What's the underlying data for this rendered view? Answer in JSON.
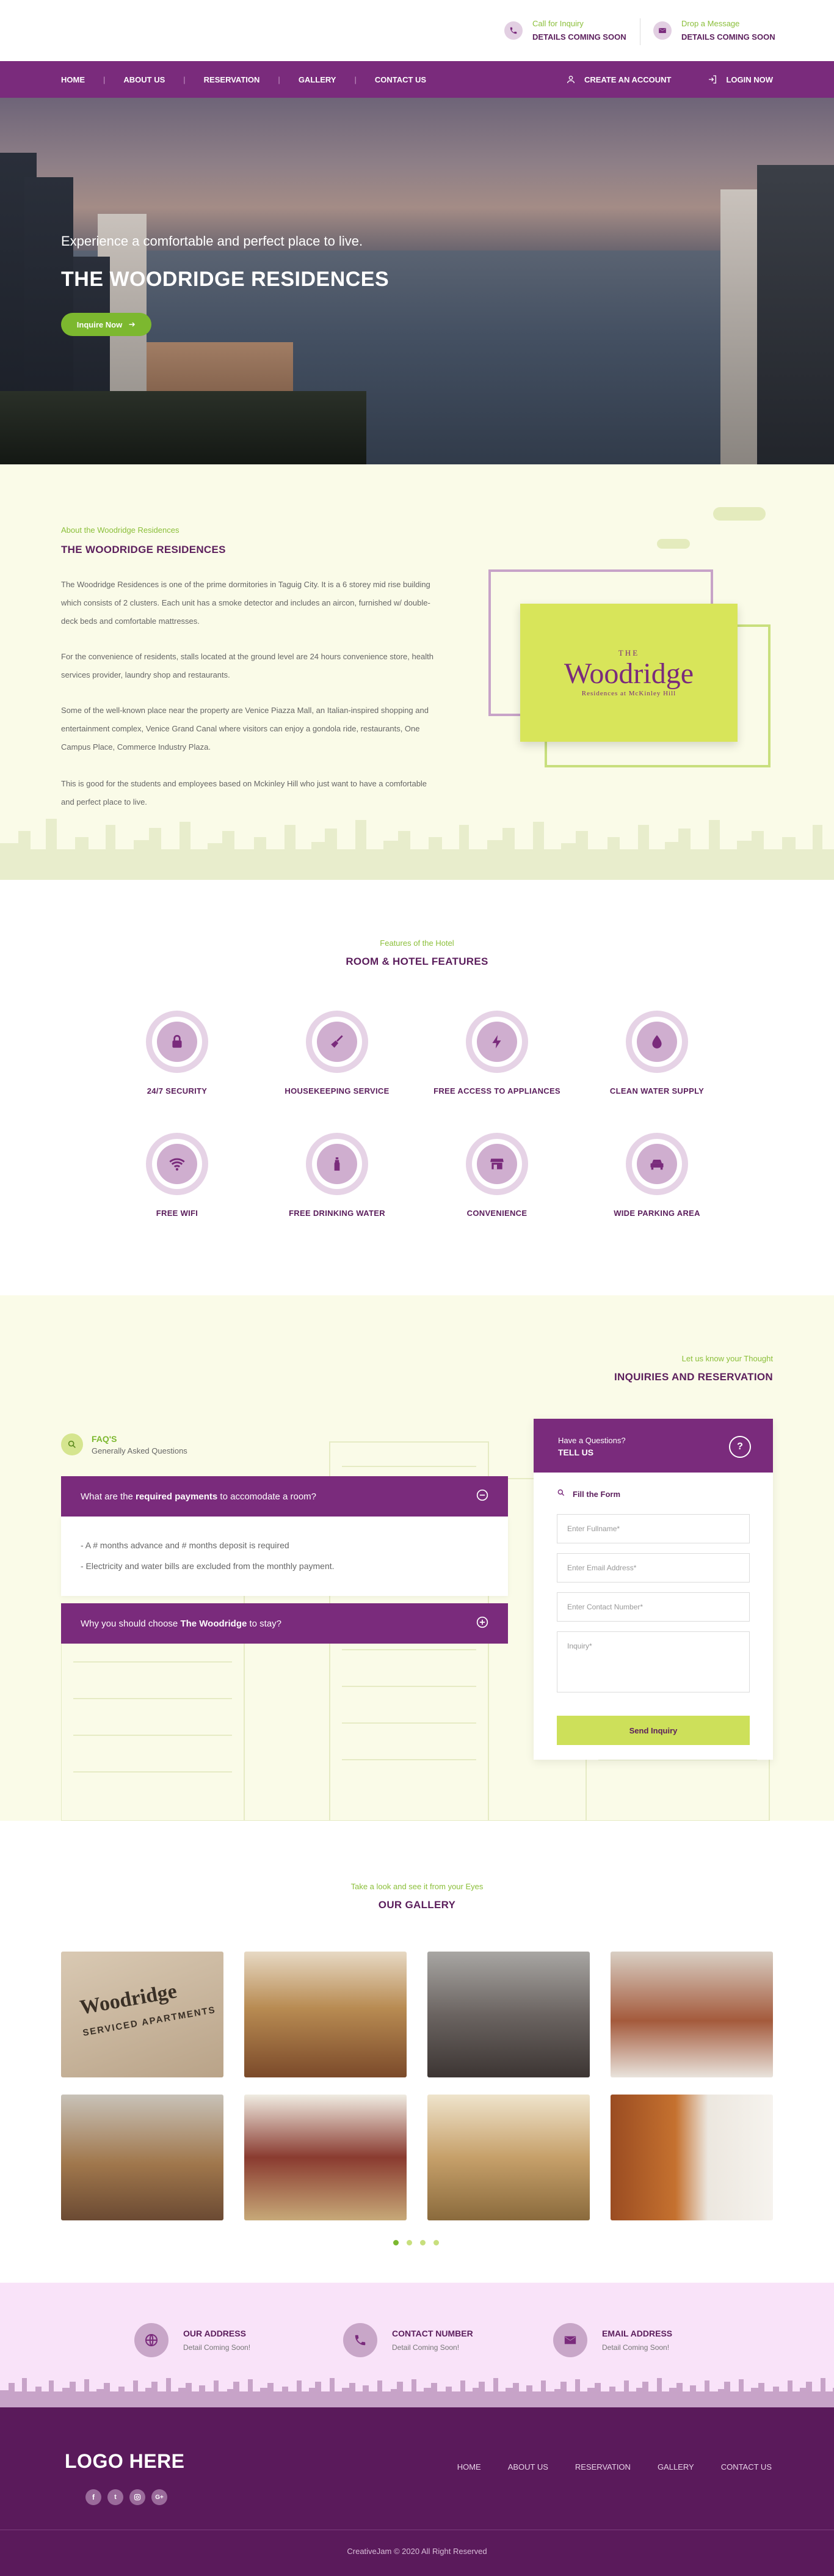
{
  "topbar": {
    "call": {
      "label": "Call for Inquiry",
      "value": "DETAILS COMING SOON",
      "icon": "phone-icon"
    },
    "message": {
      "label": "Drop a Message",
      "value": "DETAILS COMING SOON",
      "icon": "mail-icon"
    }
  },
  "nav": {
    "items": [
      "HOME",
      "ABOUT US",
      "RESERVATION",
      "GALLERY",
      "CONTACT US"
    ],
    "create_account": "CREATE AN ACCOUNT",
    "login": "LOGIN NOW"
  },
  "hero": {
    "subtitle": "Experience a comfortable and perfect place to live.",
    "title": "THE WOODRIDGE RESIDENCES",
    "button": "Inquire Now"
  },
  "about": {
    "eyebrow": "About the Woodridge Residences",
    "title": "THE WOODRIDGE RESIDENCES",
    "p1": "The Woodridge Residences is one of the prime dormitories in Taguig City. It is a 6 storey mid rise building which consists of 2 clusters. Each unit has a smoke detector and includes an aircon, furnished w/ double-deck beds and comfortable mattresses.",
    "p2": "For the convenience of residents, stalls located at the ground level are 24 hours convenience store, health services provider, laundry shop and restaurants.",
    "p3": "Some of the well-known place near the property are Venice Piazza Mall, an Italian-inspired shopping and entertainment complex,  Venice Grand Canal where visitors can enjoy a gondola ride, restaurants, One Campus Place, Commerce Industry Plaza.",
    "p4": "This is good for the students and employees based on Mckinley Hill who just want to have a comfortable and perfect place to live.",
    "logo_the": "THE",
    "logo_name": "Woodridge",
    "logo_tag": "Residences at McKinley Hill"
  },
  "features": {
    "eyebrow": "Features of the Hotel",
    "title": "ROOM & HOTEL FEATURES",
    "items": [
      {
        "label": "24/7 SECURITY",
        "icon": "lock-icon"
      },
      {
        "label": "HOUSEKEEPING SERVICE",
        "icon": "broom-icon"
      },
      {
        "label": "FREE ACCESS TO APPLIANCES",
        "icon": "lightning-icon"
      },
      {
        "label": "CLEAN WATER SUPPLY",
        "icon": "water-drop-icon"
      },
      {
        "label": "FREE WIFI",
        "icon": "wifi-icon"
      },
      {
        "label": "FREE DRINKING WATER",
        "icon": "bottle-icon"
      },
      {
        "label": "CONVENIENCE",
        "icon": "store-icon"
      },
      {
        "label": "WIDE PARKING AREA",
        "icon": "car-icon"
      }
    ]
  },
  "inquiry": {
    "eyebrow": "Let us know your Thought",
    "title": "INQUIRIES AND RESERVATION",
    "faq_title": "FAQ'S",
    "faq_sub": "Generally Asked Questions",
    "q1_pre": "What are the ",
    "q1_bold": "required payments",
    "q1_post": " to accomodate a room?",
    "a1_line1": "- A # months advance and # months deposit is required",
    "a1_line2": "- Electricity and water bills are excluded from the monthly payment.",
    "q2_pre": "Why you should choose ",
    "q2_bold": "The Woodridge",
    "q2_post": " to stay?",
    "form_small": "Have a Questions?",
    "form_title": "TELL US",
    "fill_form": "Fill the Form",
    "ph_name": "Enter Fullname*",
    "ph_email": "Enter Email Address*",
    "ph_contact": "Enter Contact Number*",
    "ph_inquiry": "Inquiry*",
    "send": "Send Inquiry"
  },
  "gallery": {
    "eyebrow": "Take a look  and see it from your Eyes",
    "title": "OUR GALLERY",
    "sign_line1": "Woodridge",
    "sign_line2": "SERVICED APARTMENTS"
  },
  "info": {
    "address": {
      "title": "OUR ADDRESS",
      "text": "Detail Coming Soon!",
      "icon": "globe-icon"
    },
    "contact": {
      "title": "CONTACT NUMBER",
      "text": "Detail Coming Soon!",
      "icon": "phone-icon"
    },
    "email": {
      "title": "EMAIL ADDRESS",
      "text": "Detail Coming Soon!",
      "icon": "mail-icon"
    }
  },
  "footer": {
    "logo": "LOGO HERE",
    "nav": [
      "HOME",
      "ABOUT US",
      "RESERVATION",
      "GALLERY",
      "CONTACT US"
    ],
    "copyright": "CreativeJam © 2020 All Right Reserved",
    "social": [
      "facebook-icon",
      "twitter-icon",
      "instagram-icon",
      "google-plus-icon"
    ]
  },
  "colors": {
    "purple": "#7a2b7c",
    "green": "#7cb82f",
    "lime": "#d8e55a",
    "cream": "#fafbe8"
  }
}
